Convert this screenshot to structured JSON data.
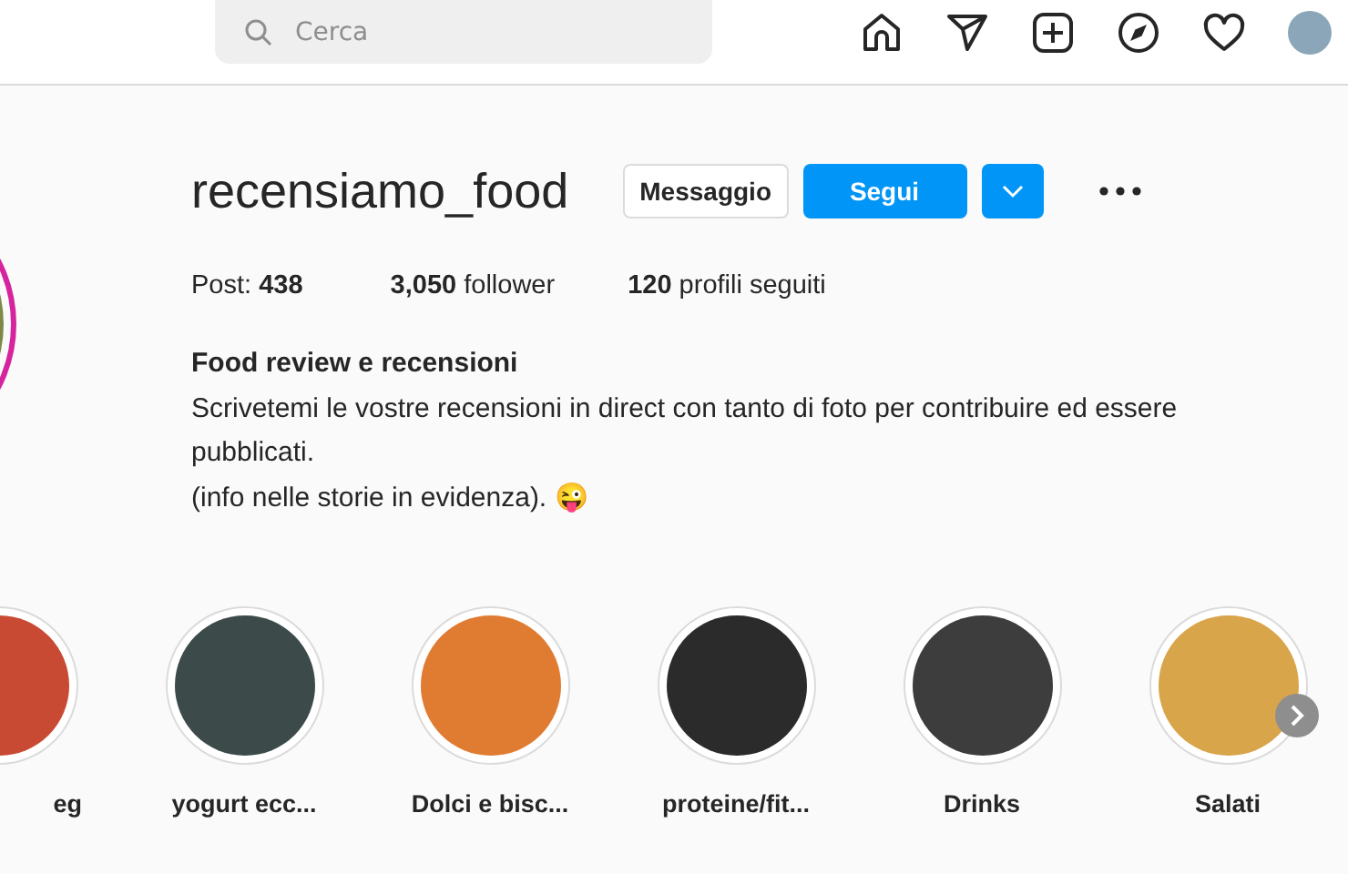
{
  "header": {
    "search": {
      "placeholder": "Cerca"
    }
  },
  "profile": {
    "username": "recensiamo_food",
    "buttons": [
      {
        "kind": "secondary",
        "label": "Messaggio"
      },
      {
        "kind": "primary",
        "label": "Segui"
      },
      {
        "kind": "dropdown"
      },
      {
        "kind": "more"
      }
    ],
    "stats": [
      "Post: **438**",
      "**3,050** follower",
      "**120** profili seguiti"
    ],
    "bio_title": "Food review e recensioni",
    "bio_lines": [
      "Scrivetemi le vostre recensioni in direct con tanto di foto per contribuire ed essere pubblicati.",
      "(info nelle storie in evidenza). 😜"
    ]
  },
  "highlights": [
    {
      "label": "eg"
    },
    {
      "label": "yogurt ecc..."
    },
    {
      "label": "Dolci e bisc..."
    },
    {
      "label": "proteine/fit..."
    },
    {
      "label": "Drinks"
    },
    {
      "label": "Salati"
    }
  ]
}
